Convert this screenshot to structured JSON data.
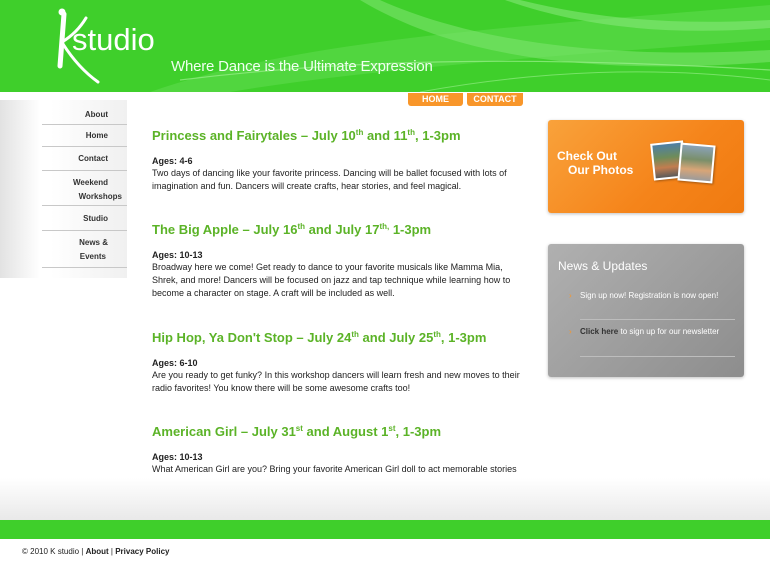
{
  "header": {
    "logo_k": "K",
    "logo_rest": "studio",
    "tagline": "Where Dance is the Ultimate Expression"
  },
  "topnav": {
    "home": "HOME",
    "contact": "CONTACT"
  },
  "sidebar": {
    "items": [
      {
        "lines": [
          "About"
        ]
      },
      {
        "lines": [
          "Home"
        ]
      },
      {
        "lines": [
          "Contact"
        ]
      },
      {
        "lines": [
          "Weekend",
          "Workshops"
        ]
      },
      {
        "lines": [
          "Studio"
        ]
      },
      {
        "lines": [
          "News &",
          "Events"
        ]
      }
    ]
  },
  "workshops": [
    {
      "title_a": "Princess and Fairytales  – July 10",
      "sup_a": "th",
      "title_b": " and 11",
      "sup_b": "th",
      "title_c": ", 1-3pm",
      "ages": "Ages: 4-6",
      "body": "Two days of dancing like your favorite princess.  Dancing will be ballet focused with lots of imagination and fun.  Dancers will create crafts, hear stories, and feel magical."
    },
    {
      "title_a": "The Big Apple – July 16",
      "sup_a": "th",
      "title_b": " and July 17",
      "sup_b": "th,",
      "title_c": " 1-3pm",
      "ages": "Ages: 10-13",
      "body": "Broadway here we come!  Get ready to dance to your favorite musicals like Mamma Mia, Shrek, and more!  Dancers will be focused on jazz and tap technique while learning how to become a character on stage. A craft will be included as well."
    },
    {
      "title_a": "Hip Hop, Ya Don't Stop – July 24",
      "sup_a": "th",
      "title_b": " and July 25",
      "sup_b": "th",
      "title_c": ", 1-3pm",
      "ages": "Ages: 6-10",
      "body": "Are you ready to get funky?  In this workshop dancers will learn fresh and new moves to their radio favorites!  You know there will be some awesome crafts too!"
    },
    {
      "title_a": "American Girl – July 31",
      "sup_a": "st",
      "title_b": " and August 1",
      "sup_b": "st",
      "title_c": ", 1-3pm",
      "ages": "Ages: 10-13",
      "body": "What American Girl are you?  Bring your favorite American Girl doll to act memorable stories from these timeless books.  A bit of acting and dancing will occur in the two days, along with a craft."
    }
  ],
  "photos_box": {
    "line1": "Check Out",
    "line2": "Our Photos"
  },
  "news": {
    "title": "News & Updates",
    "item1": "Sign up now! Registration is now open!",
    "item2_link": "Click here",
    "item2_rest": " to sign up for our newsletter"
  },
  "footer": {
    "copyright": "© 2010 K studio | ",
    "about": "About",
    "sep": " | ",
    "privacy": "Privacy Policy"
  },
  "colors": {
    "brand_green": "#3fcf2b",
    "heading_green": "#5bb327",
    "accent_orange": "#f8962a",
    "panel_gray": "#9b9b9b"
  }
}
